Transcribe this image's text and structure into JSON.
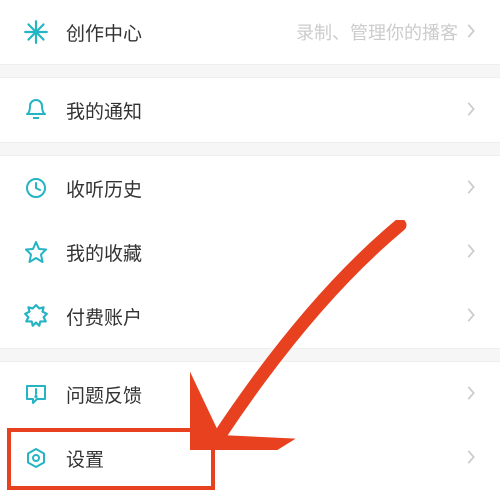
{
  "accent": "#25b4c4",
  "items": {
    "creator": {
      "label": "创作中心",
      "hint": "录制、管理你的播客"
    },
    "notifications": {
      "label": "我的通知"
    },
    "history": {
      "label": "收听历史"
    },
    "favorites": {
      "label": "我的收藏"
    },
    "paid": {
      "label": "付费账户"
    },
    "feedback": {
      "label": "问题反馈"
    },
    "settings": {
      "label": "设置"
    }
  }
}
